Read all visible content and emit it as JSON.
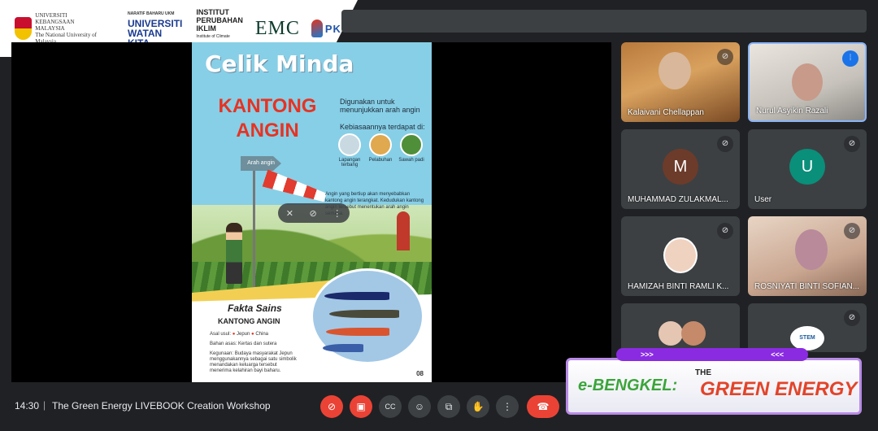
{
  "banner": {
    "ukm": [
      "UNIVERSITI",
      "KEBANGSAAN",
      "MALAYSIA",
      "The National University of Malaysia"
    ],
    "wk_top": "NARATIF BAHARU UKM",
    "wk_main": "UNIVERSITI",
    "wk_sub": "WATAN KITA",
    "ipi": [
      "INSTITUT",
      "PERUBAHAN",
      "IKLIM"
    ],
    "ipi_en": "Institute of Climate Change",
    "emc": "EMC",
    "pkas": "PKAS"
  },
  "slide": {
    "title1": "Celik Minda",
    "title2": "KANTONG ANGIN",
    "desc": "Digunakan untuk menunjukkan arah angin",
    "desc2": "Kebiasaannya terdapat di:",
    "places": [
      "Lapangan terbang",
      "Pelabuhan",
      "Sawah padi"
    ],
    "arrow_label": "Arah angin",
    "para": "Angin yang bertiup akan menyebabkan kantong angin terangkat. Kedudukan kantong angin tersebut menentukan arah angin semasa.",
    "fakta_title": "Fakta Sains",
    "fakta_sub": "KANTONG ANGIN",
    "asal_label": "Asal usul:",
    "asal_1": "Jepun",
    "asal_2": "China",
    "bahan": "Bahan asas: Kertas dan sutera",
    "kegunaan": "Kegunaan: Budaya masyarakat Jepun menggunakannya sebagai satu simbolik menandakan keluarga tersebut menerima kelahiran bayi baharu.",
    "page": "08"
  },
  "participants": [
    {
      "name": "Kalaivani Chellappan",
      "type": "video"
    },
    {
      "name": "Nurul Asyikin Razali",
      "type": "video",
      "speaking": true
    },
    {
      "name": "MUHAMMAD ZULAKMAL...",
      "type": "avatar",
      "initial": "M",
      "color": "#6d3b2a"
    },
    {
      "name": "User",
      "type": "avatar",
      "initial": "U",
      "color": "#0a8f7a"
    },
    {
      "name": "HAMIZAH BINTI RAMLI K...",
      "type": "photo"
    },
    {
      "name": "ROSNIYATI BINTI SOFIAN...",
      "type": "video"
    }
  ],
  "green_banner": {
    "arrows_left": ">>>",
    "arrows_right": "<<<",
    "bengkel": "e-BENGKEL:",
    "the": "THE",
    "green_energy": "GREEN ENERGY",
    "stem": "STEM"
  },
  "bottom_bar": {
    "time": "14:30",
    "separator": "|",
    "meeting_title": "The Green Energy LIVEBOOK Creation Workshop"
  }
}
